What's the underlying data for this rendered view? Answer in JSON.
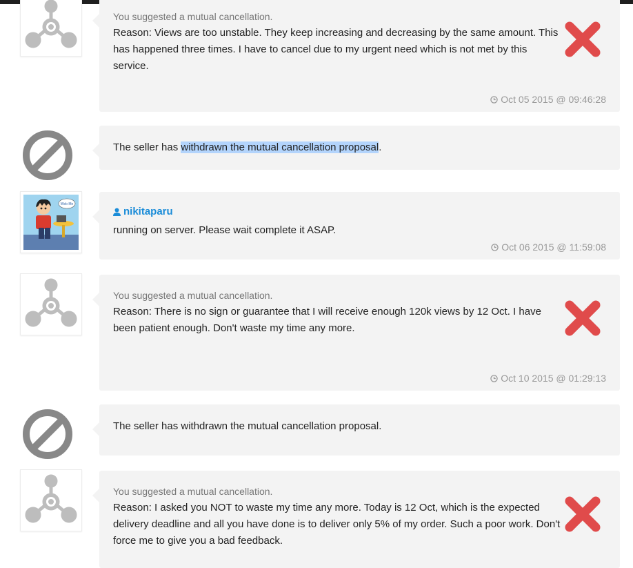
{
  "colors": {
    "bubble_bg": "#f3f3f3",
    "cancel_red": "#e04b4b",
    "icon_gray": "#888888",
    "username_blue": "#1a8cd8",
    "selection_highlight": "#b3d4fc"
  },
  "messages": [
    {
      "type": "cancellation_suggestion",
      "label": "You suggested a mutual cancellation.",
      "reason": "Reason: Views are too unstable. They keep increasing and decreasing by the same amount. This has happened three times. I have to cancel due to my urgent need which is not met by this service.",
      "timestamp": "Oct 05 2015 @ 09:46:28",
      "icon": "x-icon"
    },
    {
      "type": "system",
      "text_before": "The seller has ",
      "text_highlighted": "withdrawn the mutual cancellation proposal",
      "text_after": ".",
      "icon": "prohibited-icon"
    },
    {
      "type": "user_message",
      "username": "nikitaparu",
      "text": "running on server. Please wait complete it ASAP.",
      "timestamp": "Oct 06 2015 @ 11:59:08",
      "avatar_bubble_text": "Web Me"
    },
    {
      "type": "cancellation_suggestion",
      "label": "You suggested a mutual cancellation.",
      "reason": "Reason: There is no sign or guarantee that I will receive enough 120k views by 12 Oct. I have been patient enough. Don't waste my time any more.",
      "timestamp": "Oct 10 2015 @ 01:29:13",
      "icon": "x-icon"
    },
    {
      "type": "system",
      "text": "The seller has withdrawn the mutual cancellation proposal.",
      "icon": "prohibited-icon"
    },
    {
      "type": "cancellation_suggestion",
      "label": "You suggested a mutual cancellation.",
      "reason": "Reason: I asked you NOT to waste my time any more. Today is 12 Oct, which is the expected delivery deadline and all you have done is to deliver only 5% of my order. Such a poor work. Don't force me to give you a bad feedback.",
      "icon": "x-icon"
    }
  ]
}
